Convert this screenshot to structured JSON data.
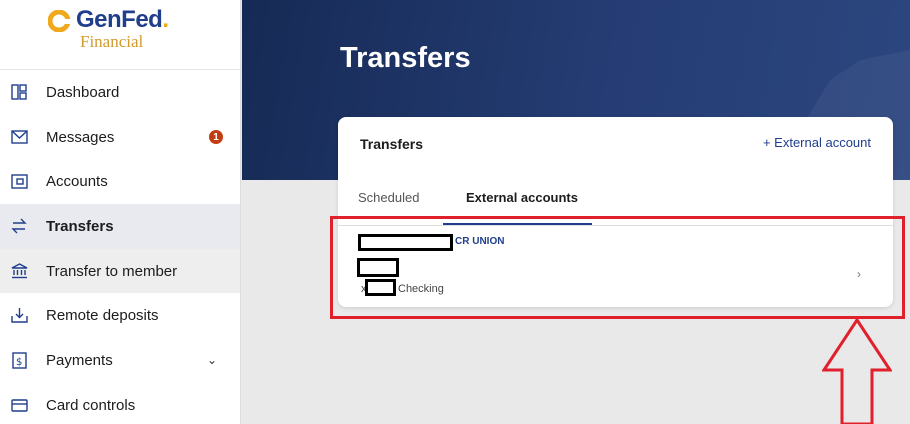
{
  "logo": {
    "name": "GenFed",
    "dot": ".",
    "sub": "Financial"
  },
  "sidebar": {
    "items": [
      {
        "label": "Dashboard",
        "icon": "dashboard-icon"
      },
      {
        "label": "Messages",
        "icon": "envelope-icon",
        "badge": "1"
      },
      {
        "label": "Accounts",
        "icon": "wallet-icon"
      },
      {
        "label": "Transfers",
        "icon": "transfer-arrows-icon",
        "active": true
      },
      {
        "label": "Transfer to member",
        "icon": "bank-icon"
      },
      {
        "label": "Remote deposits",
        "icon": "deposit-icon"
      },
      {
        "label": "Payments",
        "icon": "payments-icon",
        "chevron": "⌄"
      },
      {
        "label": "Card controls",
        "icon": "card-icon"
      }
    ]
  },
  "header": {
    "title": "Transfers"
  },
  "card": {
    "title": "Transfers",
    "add_external": "+ External account",
    "tabs": [
      {
        "label": "Scheduled"
      },
      {
        "label": "External accounts",
        "selected": true
      }
    ],
    "account": {
      "bank_name": "CR UNION",
      "type": "Checking",
      "prefix": "x",
      "chevron": "›"
    }
  },
  "colors": {
    "brand_blue": "#1f3e8c",
    "brand_gold": "#f0a81c",
    "badge_red": "#c33d12",
    "annotation_red": "#e0202a"
  }
}
